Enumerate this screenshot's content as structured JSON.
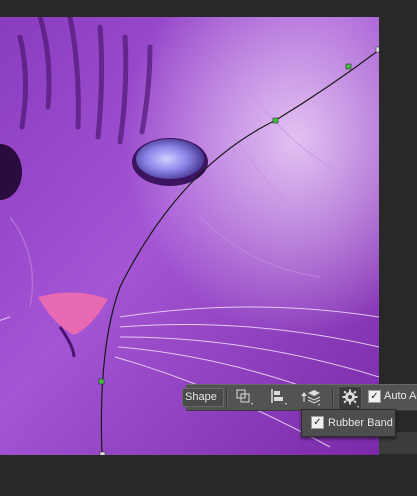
{
  "options_bar": {
    "shape_label": "Shape",
    "auto_add_label": "Auto Ac",
    "auto_add_checked": true
  },
  "settings_dropdown": {
    "rubber_band_label": "Rubber Band",
    "rubber_band_checked": true
  },
  "icons": [
    "path-operations-icon",
    "path-alignment-icon",
    "path-arrangement-icon",
    "gear-icon"
  ],
  "colors": {
    "canvas_tint": "#9b42c8",
    "path_stroke": "#1a1a1a",
    "anchor_point": "#3fbf3f",
    "options_bar_bg": "#535353",
    "workspace_bg": "#282828"
  }
}
